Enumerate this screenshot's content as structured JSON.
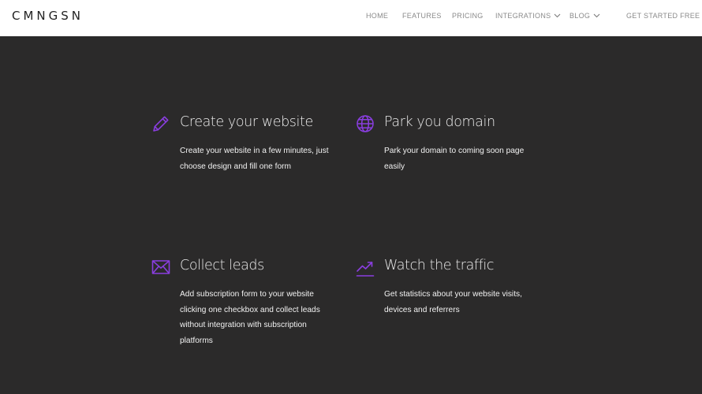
{
  "header": {
    "logo": "CMNGSN",
    "nav": [
      {
        "label": "HOME",
        "dropdown": false
      },
      {
        "label": "FEATURES",
        "dropdown": false
      },
      {
        "label": "PRICING",
        "dropdown": false
      },
      {
        "label": "INTEGRATIONS",
        "dropdown": true
      },
      {
        "label": "BLOG",
        "dropdown": true
      },
      {
        "label": "GET STARTED FREE",
        "dropdown": false
      }
    ]
  },
  "features": [
    {
      "icon": "pencil-icon",
      "title": "Create your website",
      "text": "Create your website in a few minutes, just choose design and fill one form"
    },
    {
      "icon": "globe-icon",
      "title": "Park you domain",
      "text": "Park your domain to coming soon page easily"
    },
    {
      "icon": "envelope-icon",
      "title": "Collect leads",
      "text": "Add subscription form to your website clicking one checkbox and collect leads without integration with subscription platforms"
    },
    {
      "icon": "trending-up-icon",
      "title": "Watch the traffic",
      "text": "Get statistics about your website visits, devices and referrers"
    }
  ],
  "colors": {
    "background": "#2b2a2a",
    "header_bg": "#ffffff",
    "accent": "#8a3ee0",
    "nav_text": "#8a8a8a"
  }
}
